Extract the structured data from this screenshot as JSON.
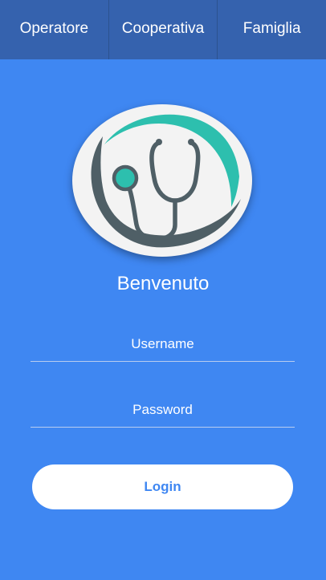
{
  "tabs": [
    {
      "label": "Operatore"
    },
    {
      "label": "Cooperativa"
    },
    {
      "label": "Famiglia"
    }
  ],
  "logo": {
    "icon": "stethoscope-icon"
  },
  "welcome": "Benvenuto",
  "form": {
    "username_placeholder": "Username",
    "username_value": "",
    "password_placeholder": "Password",
    "password_value": "",
    "login_label": "Login"
  },
  "colors": {
    "background": "#3f87f2",
    "tabbar": "#3562ae",
    "logo_teal": "#2dbfae",
    "logo_gray": "#4f5f66",
    "button_bg": "#ffffff",
    "button_text": "#3f87f2"
  }
}
